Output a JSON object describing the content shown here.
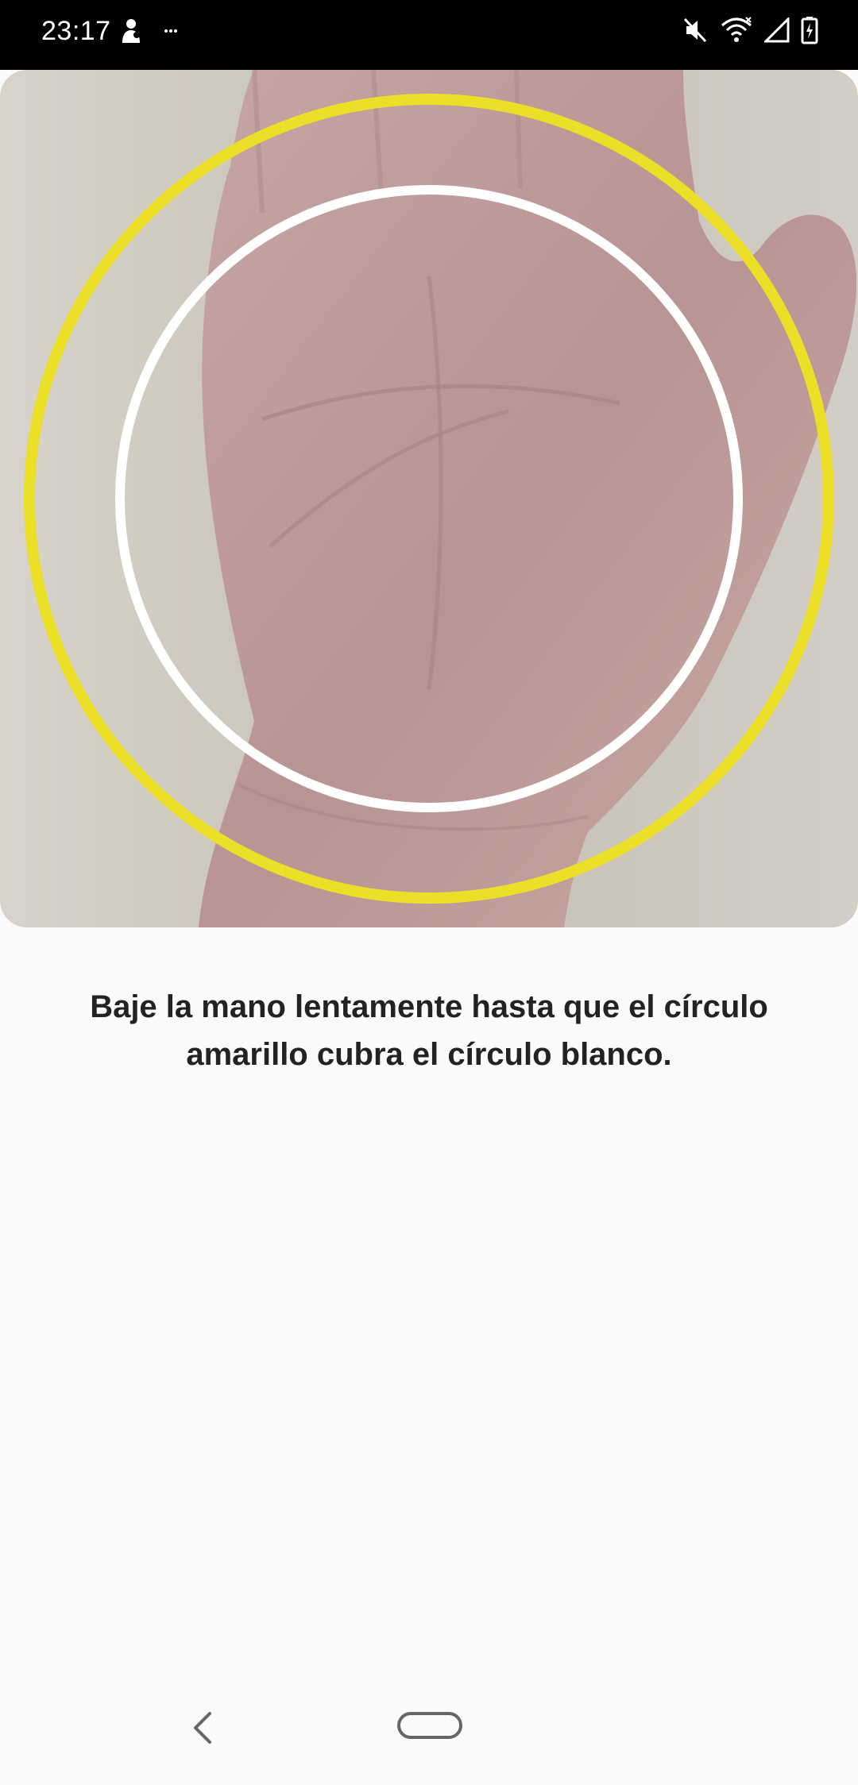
{
  "status_bar": {
    "time": "23:17",
    "left_icons": [
      "notification-person-icon",
      "more-notifications-icon"
    ],
    "right_icons": [
      "mute-icon",
      "wifi-icon",
      "cell-signal-icon",
      "battery-charging-icon"
    ]
  },
  "camera": {
    "subject": "hand-palm",
    "outer_circle_color": "#ecdf28",
    "inner_circle_color": "#ffffff"
  },
  "instruction": {
    "text": "Baje la mano lentamente hasta que el círculo amarillo cubra el círculo blanco."
  },
  "navigation": {
    "back": "back-icon",
    "home": "home-icon"
  }
}
